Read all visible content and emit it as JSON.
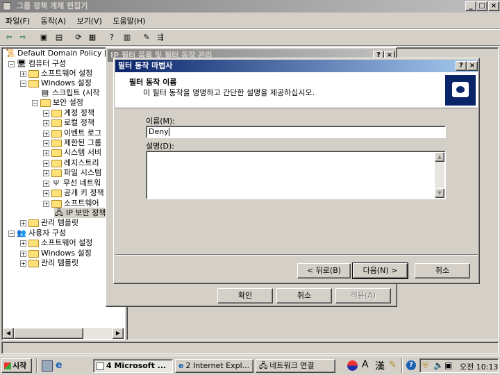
{
  "main_window": {
    "title": "그룹 정책 개체 편집기",
    "menu": [
      "파일(F)",
      "동작(A)",
      "보기(V)",
      "도움말(H)"
    ],
    "tree": {
      "root": "Default Domain Policy [I",
      "computer_config": "컴퓨터 구성",
      "software_settings": "소프트웨어 설정",
      "windows_settings": "Windows 설정",
      "scripts": "스크립트 (시작",
      "security_settings": "보안 설정",
      "account_policy": "계정 정책",
      "local_policy": "로컬 정책",
      "event_log": "이벤트 로그",
      "restricted_groups": "제한된 그룹",
      "system_services": "시스템 서비",
      "registry": "레지스트리",
      "file_system": "파일 시스템",
      "wireless_network": "무선 네트워",
      "public_key": "공개 키 정책",
      "software_restriction": "소프트웨어",
      "ip_security": "IP 보안 정책",
      "admin_templates": "관리 템플릿",
      "user_config": "사용자 구성",
      "user_software_settings": "소프트웨어 설정",
      "user_windows_settings": "Windows 설정",
      "user_admin_templates": "관리 템플릿"
    }
  },
  "behind_dialog": {
    "title": "IP 필터 목록 및 필터 동작 관리",
    "ok_label": "확인",
    "cancel_label": "취소",
    "apply_label": "적용(A)"
  },
  "wizard": {
    "title": "필터 동작 마법사",
    "heading": "필터 동작 이름",
    "subheading": "이 필터 동작을 명명하고 간단한 설명을 제공하십시오.",
    "name_label": "이름(M):",
    "name_value": "Deny",
    "desc_label": "설명(D):",
    "desc_value": "",
    "back_label": "< 뒤로(B)",
    "next_label": "다음(N) >",
    "cancel_label": "취소"
  },
  "taskbar": {
    "start_label": "시작",
    "tasks": [
      "4 Microsoft ...",
      "2 Internet Expl...",
      "네트워크 연결"
    ],
    "tray_a": "A",
    "tray_han": "漢",
    "time_prefix": "오전",
    "time": "10:13"
  }
}
